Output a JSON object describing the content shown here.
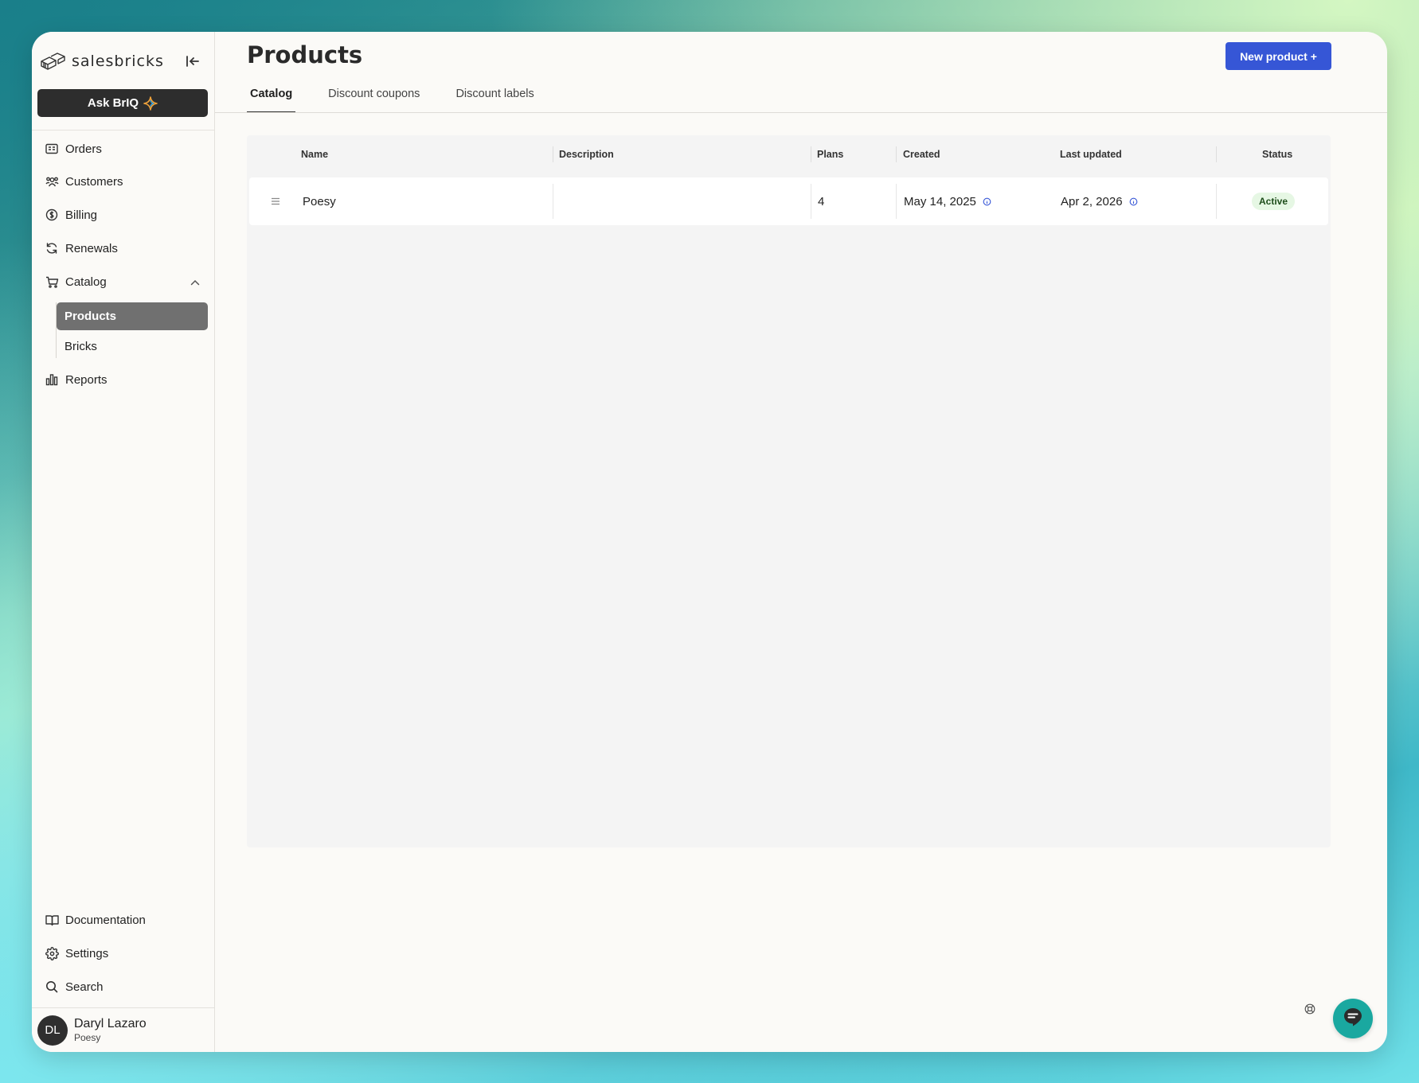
{
  "sidebar": {
    "brand": "salesbricks",
    "ask_label": "Ask BrIQ",
    "nav": {
      "orders": "Orders",
      "customers": "Customers",
      "billing": "Billing",
      "renewals": "Renewals",
      "catalog": "Catalog",
      "products": "Products",
      "bricks": "Bricks",
      "reports": "Reports",
      "documentation": "Documentation",
      "settings": "Settings",
      "search": "Search"
    },
    "user": {
      "initials": "DL",
      "name": "Daryl Lazaro",
      "org": "Poesy"
    }
  },
  "main": {
    "title": "Products",
    "new_button": "New product +",
    "tabs": [
      "Catalog",
      "Discount coupons",
      "Discount labels"
    ],
    "active_tab": "Catalog",
    "table": {
      "headers": {
        "name": "Name",
        "description": "Description",
        "plans": "Plans",
        "created": "Created",
        "last_updated": "Last updated",
        "status": "Status"
      },
      "rows": [
        {
          "name": "Poesy",
          "description": "",
          "plans": "4",
          "created": "May 14, 2025",
          "last_updated": "Apr 2, 2026",
          "status": "Active"
        }
      ]
    }
  },
  "colors": {
    "primary_button": "#3656d6",
    "active_nav_bg": "#707070",
    "status_active_bg": "#e6f7e4",
    "chat_button": "#1aa8a0"
  }
}
